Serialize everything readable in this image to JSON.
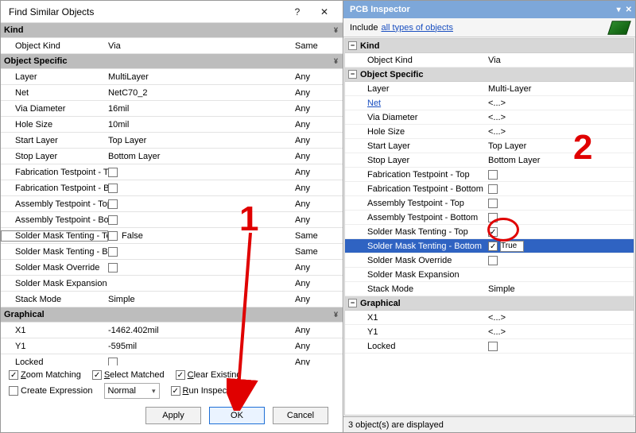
{
  "dialog": {
    "title": "Find Similar Objects",
    "sections": {
      "kind": {
        "label": "Kind",
        "rows": [
          {
            "name": "Object Kind",
            "value": "Via",
            "match": "Same"
          }
        ]
      },
      "obj": {
        "label": "Object Specific",
        "rows": [
          {
            "name": "Layer",
            "value": "MultiLayer",
            "match": "Any"
          },
          {
            "name": "Net",
            "value": "NetC70_2",
            "match": "Any"
          },
          {
            "name": "Via Diameter",
            "value": "16mil",
            "match": "Any"
          },
          {
            "name": "Hole Size",
            "value": "10mil",
            "match": "Any"
          },
          {
            "name": "Start Layer",
            "value": "Top Layer",
            "match": "Any"
          },
          {
            "name": "Stop Layer",
            "value": "Bottom Layer",
            "match": "Any"
          },
          {
            "name": "Fabrication Testpoint - Top",
            "value": "",
            "cb": false,
            "match": "Any"
          },
          {
            "name": "Fabrication Testpoint - Bottom",
            "value": "",
            "cb": false,
            "match": "Any"
          },
          {
            "name": "Assembly Testpoint - Top",
            "value": "",
            "cb": false,
            "match": "Any"
          },
          {
            "name": "Assembly Testpoint - Bottom",
            "value": "",
            "cb": false,
            "match": "Any"
          },
          {
            "name": "Solder Mask Tenting - Top",
            "value": "False",
            "cb": false,
            "match": "Same",
            "selected": true
          },
          {
            "name": "Solder Mask Tenting - Bottom",
            "value": "",
            "cb": false,
            "match": "Same"
          },
          {
            "name": "Solder Mask Override",
            "value": "",
            "cb": false,
            "match": "Any"
          },
          {
            "name": "Solder Mask Expansion",
            "value": "",
            "match": "Any"
          },
          {
            "name": "Stack Mode",
            "value": "Simple",
            "match": "Any"
          }
        ]
      },
      "gfx": {
        "label": "Graphical",
        "rows": [
          {
            "name": "X1",
            "value": "-1462.402mil",
            "match": "Any"
          },
          {
            "name": "Y1",
            "value": "-595mil",
            "match": "Any"
          },
          {
            "name": "Locked",
            "value": "",
            "cb": false,
            "match": "Any"
          }
        ]
      }
    },
    "options": {
      "zoom": {
        "label": "Zoom Matching",
        "letter": "Z",
        "checked": true
      },
      "select": {
        "label": "Select Matched",
        "letter": "S",
        "checked": true
      },
      "clear": {
        "label": "Clear Existing",
        "letter": "C",
        "checked": true
      },
      "create": {
        "label": "Create Expression",
        "checked": false
      },
      "mask": {
        "label": "Normal"
      },
      "run": {
        "label": "Run Inspector",
        "letter": "R",
        "checked": true
      }
    },
    "buttons": {
      "apply": "Apply",
      "ok": "OK",
      "cancel": "Cancel"
    }
  },
  "inspector": {
    "title": "PCB Inspector",
    "include_prefix": "Include",
    "include_link": "all types of objects",
    "sections": {
      "kind": {
        "label": "Kind",
        "rows": [
          {
            "name": "Object Kind",
            "value": "Via"
          }
        ]
      },
      "obj": {
        "label": "Object Specific",
        "rows": [
          {
            "name": "Layer",
            "value": "Multi-Layer"
          },
          {
            "name": "Net",
            "value": "<...>",
            "link": true
          },
          {
            "name": "Via Diameter",
            "value": "<...>"
          },
          {
            "name": "Hole Size",
            "value": "<...>"
          },
          {
            "name": "Start Layer",
            "value": "Top Layer"
          },
          {
            "name": "Stop Layer",
            "value": "Bottom Layer"
          },
          {
            "name": "Fabrication Testpoint - Top",
            "cb": false
          },
          {
            "name": "Fabrication Testpoint - Bottom",
            "cb": false
          },
          {
            "name": "Assembly Testpoint - Top",
            "cb": false
          },
          {
            "name": "Assembly Testpoint - Bottom",
            "cb": false
          },
          {
            "name": "Solder Mask Tenting - Top",
            "cb": true
          },
          {
            "name": "Solder Mask Tenting - Bottom",
            "cb": true,
            "edit": "True",
            "selected": true
          },
          {
            "name": "Solder Mask Override",
            "cb": false
          },
          {
            "name": "Solder Mask Expansion",
            "value": ""
          },
          {
            "name": "Stack Mode",
            "value": "Simple"
          }
        ]
      },
      "gfx": {
        "label": "Graphical",
        "rows": [
          {
            "name": "X1",
            "value": "<...>"
          },
          {
            "name": "Y1",
            "value": "<...>"
          },
          {
            "name": "Locked",
            "cb": false
          }
        ]
      }
    },
    "status": "3 object(s) are displayed"
  },
  "annotations": {
    "one": "1",
    "two": "2"
  }
}
